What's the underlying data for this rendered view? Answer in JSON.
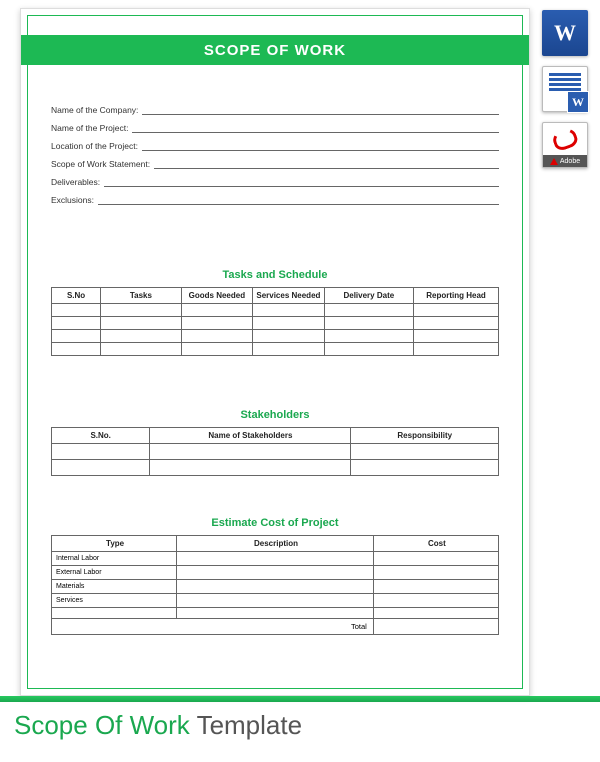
{
  "header": {
    "title": "SCOPE OF WORK"
  },
  "fields": [
    {
      "label": "Name of the Company:"
    },
    {
      "label": "Name of the Project:"
    },
    {
      "label": "Location of the Project:"
    },
    {
      "label": "Scope of Work Statement:"
    },
    {
      "label": "Deliverables:"
    },
    {
      "label": "Exclusions:"
    }
  ],
  "tasks": {
    "title": "Tasks and Schedule",
    "headers": [
      "S.No",
      "Tasks",
      "Goods Needed",
      "Services Needed",
      "Delivery Date",
      "Reporting Head"
    ]
  },
  "stakeholders": {
    "title": "Stakeholders",
    "headers": [
      "S.No.",
      "Name of Stakeholders",
      "Responsibility"
    ]
  },
  "cost": {
    "title": "Estimate Cost of Project",
    "headers": [
      "Type",
      "Description",
      "Cost"
    ],
    "rows": [
      "Internal Labor",
      "External Labor",
      "Materials",
      "Services"
    ],
    "total_label": "Total"
  },
  "footer": {
    "green": "Scope Of Work",
    "gray": " Template"
  },
  "icons": {
    "word": "W",
    "adobe": "Adobe"
  }
}
